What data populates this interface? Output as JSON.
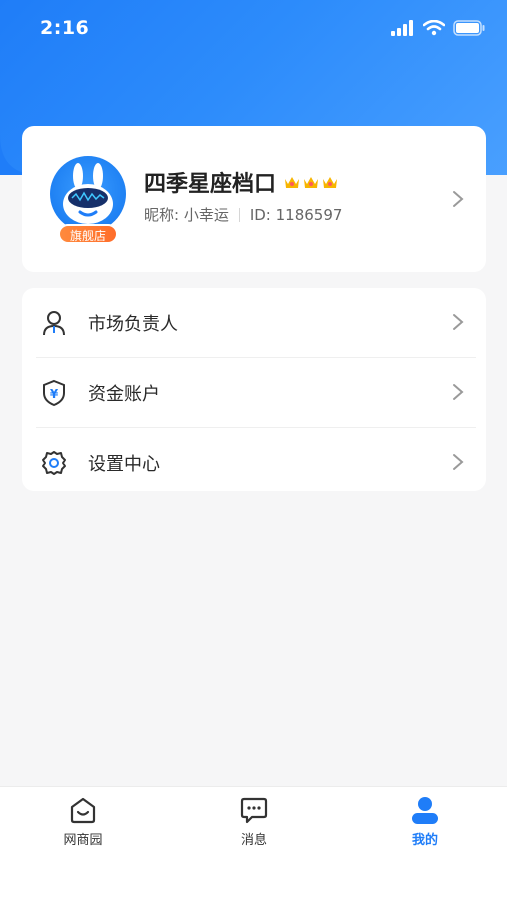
{
  "status_bar": {
    "time": "2:16"
  },
  "profile": {
    "shop_name": "四季星座档口",
    "store_badge": "旗舰店",
    "nickname": "昵称: 小幸运",
    "user_id": "ID: 1186597",
    "crown_count": 3
  },
  "menu": {
    "items": [
      {
        "label": "市场负责人",
        "icon": "person-icon"
      },
      {
        "label": "资金账户",
        "icon": "yen-shield-icon"
      },
      {
        "label": "设置中心",
        "icon": "gear-icon"
      }
    ]
  },
  "tabbar": {
    "tabs": [
      {
        "label": "网商园",
        "icon": "home-icon",
        "active": false
      },
      {
        "label": "消息",
        "icon": "chat-icon",
        "active": false
      },
      {
        "label": "我的",
        "icon": "user-icon",
        "active": true
      }
    ]
  },
  "colors": {
    "primary": "#1f7df8",
    "badge_orange": "#ff7a33",
    "crown_gold": "#f7b500"
  }
}
